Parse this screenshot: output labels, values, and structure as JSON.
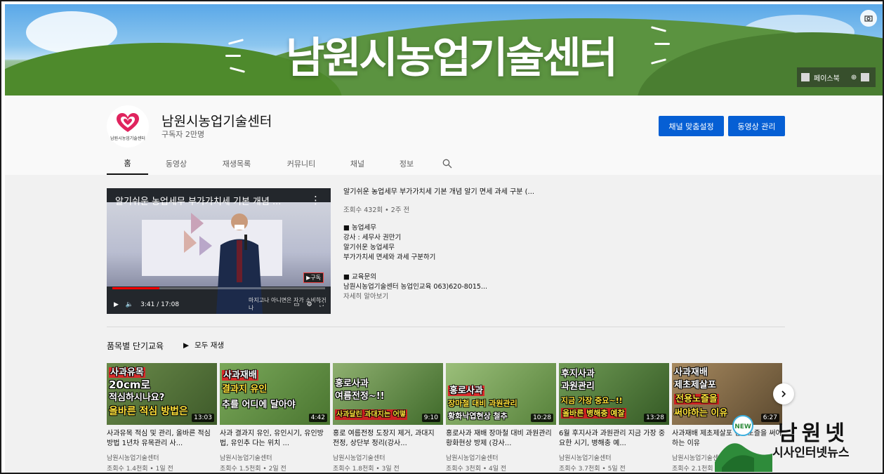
{
  "banner": {
    "title": "남원시농업기술센터",
    "links_label": "페이스북",
    "camera_icon": "camera-icon"
  },
  "channel": {
    "name": "남원시농업기술센터",
    "subscribers": "구독자 2만명",
    "avatar_caption": "남원시농업기술센터",
    "customize_button": "채널 맞춤설정",
    "manage_button": "동영상 관리"
  },
  "tabs": [
    {
      "label": "홈"
    },
    {
      "label": "동영상"
    },
    {
      "label": "재생목록"
    },
    {
      "label": "커뮤니티"
    },
    {
      "label": "채널"
    },
    {
      "label": "정보"
    }
  ],
  "featured": {
    "overlay_title": "알기쉬운 농업세무 부가가치세 기본 개념 ...",
    "time": "3:41 / 17:08",
    "subtitle": "마지고나 아니면은 자가 소비하거나",
    "subscribe_badge": "구독",
    "progress": 0.22,
    "title": "알기쉬운 농업세무 부가가치세 기본 개념 알기 면세 과세 구분 (...",
    "meta": "조회수 432회 • 2주 전",
    "desc_lines": [
      "■ 농업세무",
      "강사 : 세무사 권만기",
      "알기쉬운 농업세무",
      "부가가치세 면세와 과세 구분하기"
    ],
    "inquiry_lines": [
      "■ 교육문의",
      "남원시농업기술센터 농업인교육 063)620-8015..."
    ],
    "more": "자세히 알아보기"
  },
  "shelf": {
    "title": "품목별 단기교육",
    "play_all": "모두 재생",
    "videos": [
      {
        "caption_lines": [
          "사과유목",
          "20cm로",
          "적심하시나요?",
          "올바른 적심 방법은"
        ],
        "duration": "13:03",
        "title": "사과유목 적심 및 관리, 올바른 적심방법 1년차 유목관리 사...",
        "channel": "남원시농업기술센터",
        "stats": "조회수 1.4천회 • 1일 전"
      },
      {
        "caption_lines": [
          "사과재배",
          "결과지 유인",
          "추를 어디에 달아야"
        ],
        "duration": "4:42",
        "title": "사과 결과지 유인, 유인시기, 유인방법, 유인추 다는 위치 ...",
        "channel": "남원시농업기술센터",
        "stats": "조회수 1.5천회 • 2일 전"
      },
      {
        "caption_lines": [
          "홍로사과",
          "여름전정~!!",
          "사과달린 과대지는 어떻"
        ],
        "duration": "9:10",
        "title": "홍로 여름전정 도장지 제거, 과대지 전정, 상단부 정리(강사...",
        "channel": "남원시농업기술센터",
        "stats": "조회수 1.8천회 • 3일 전"
      },
      {
        "caption_lines": [
          "홍로사과",
          "장마철 대비 과원관리",
          "황화낙엽현상 철추"
        ],
        "duration": "10:28",
        "title": "홍로사과 재배 장마철 대비 과원관리 황화현상 방제 (강사...",
        "channel": "남원시농업기술센터",
        "stats": "조회수 3천회 • 4일 전"
      },
      {
        "caption_lines": [
          "후지사과",
          "과원관리",
          "지금 가장 중요~!!",
          "올바른 병해충 예찰"
        ],
        "duration": "13:28",
        "title": "6월 후지사과 과원관리 지금 가장 중요한 시기, 병해충 예...",
        "channel": "남원시농업기술센터",
        "stats": "조회수 3.7천회 • 5일 전"
      },
      {
        "caption_lines": [
          "사과재배",
          "제초제살포",
          "전용노즐을",
          "써야하는 이유"
        ],
        "duration": "6:27",
        "title": "사과재배 제초제살포 전용노즐을 써야하는 이유",
        "channel": "남원시농업기술센터",
        "stats": "조회수 2.1천회 • 3주 전"
      }
    ]
  },
  "watermark": {
    "line1": "남원넷",
    "line2": "시사인터넷뉴스",
    "badge": "NEW"
  }
}
